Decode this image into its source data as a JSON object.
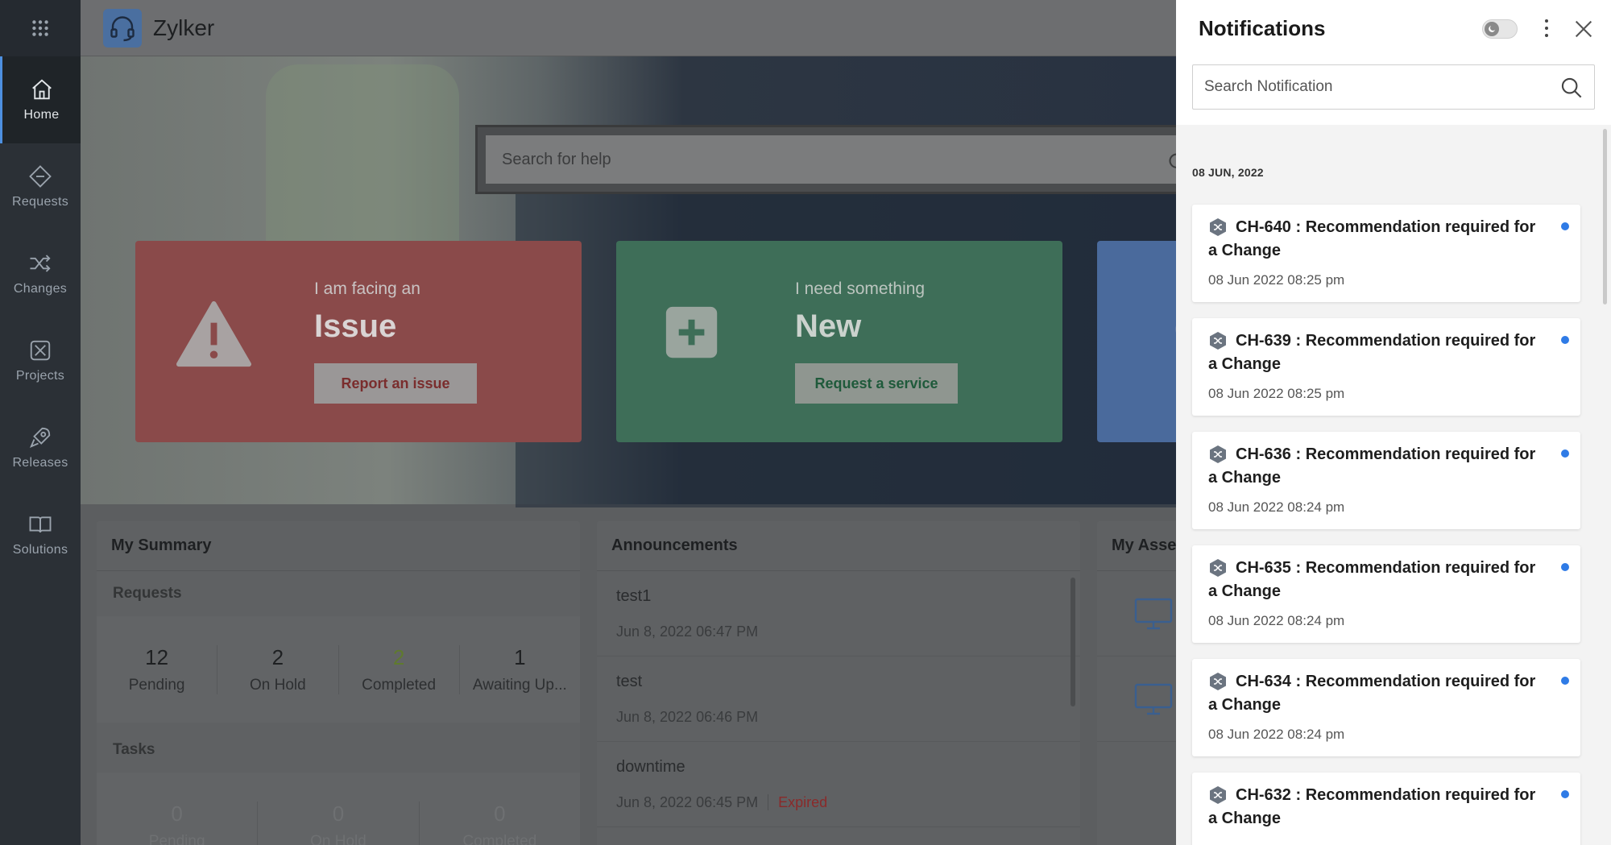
{
  "app": {
    "brand": "Zylker"
  },
  "nav": [
    {
      "label": "Home",
      "icon": "home-icon",
      "active": true
    },
    {
      "label": "Requests",
      "icon": "requests-icon"
    },
    {
      "label": "Changes",
      "icon": "changes-icon"
    },
    {
      "label": "Projects",
      "icon": "projects-icon"
    },
    {
      "label": "Releases",
      "icon": "releases-icon"
    },
    {
      "label": "Solutions",
      "icon": "solutions-icon"
    }
  ],
  "help_search": {
    "placeholder": "Search for help"
  },
  "cards": {
    "issue": {
      "sub": "I am facing an",
      "big": "Issue",
      "button": "Report an issue"
    },
    "new": {
      "sub": "I need something",
      "big": "New",
      "button": "Request a service"
    }
  },
  "summary": {
    "title": "My Summary",
    "requests_title": "Requests",
    "requests": [
      {
        "value": "12",
        "label": "Pending"
      },
      {
        "value": "2",
        "label": "On Hold"
      },
      {
        "value": "2",
        "label": "Completed"
      },
      {
        "value": "1",
        "label": "Awaiting Up..."
      }
    ],
    "tasks_title": "Tasks",
    "tasks": [
      {
        "value": "0",
        "label": "Pending"
      },
      {
        "value": "0",
        "label": "On Hold"
      },
      {
        "value": "0",
        "label": "Completed"
      }
    ]
  },
  "announcements": {
    "title": "Announcements",
    "items": [
      {
        "title": "test1",
        "date": "Jun 8, 2022 06:47 PM",
        "status": ""
      },
      {
        "title": "test",
        "date": "Jun 8, 2022 06:46 PM",
        "status": ""
      },
      {
        "title": "downtime",
        "date": "Jun 8, 2022 06:45 PM",
        "status": "Expired"
      }
    ]
  },
  "assets": {
    "title": "My Asse"
  },
  "notifications": {
    "title": "Notifications",
    "search_placeholder": "Search Notification",
    "date_group": "08 JUN, 2022",
    "items": [
      {
        "title": "CH-640 : Recommendation required for a Change",
        "time": "08 Jun 2022 08:25 pm"
      },
      {
        "title": "CH-639 : Recommendation required for a Change",
        "time": "08 Jun 2022 08:25 pm"
      },
      {
        "title": "CH-636 : Recommendation required for a Change",
        "time": "08 Jun 2022 08:24 pm"
      },
      {
        "title": "CH-635 : Recommendation required for a Change",
        "time": "08 Jun 2022 08:24 pm"
      },
      {
        "title": "CH-634 : Recommendation required for a Change",
        "time": "08 Jun 2022 08:24 pm"
      },
      {
        "title": "CH-632 : Recommendation required for a Change",
        "time": ""
      }
    ]
  },
  "colors": {
    "unread_dot": "#2f7be6",
    "issue_card": "#c25a5a",
    "new_card": "#3f9a72",
    "accent": "#4d90e0"
  }
}
